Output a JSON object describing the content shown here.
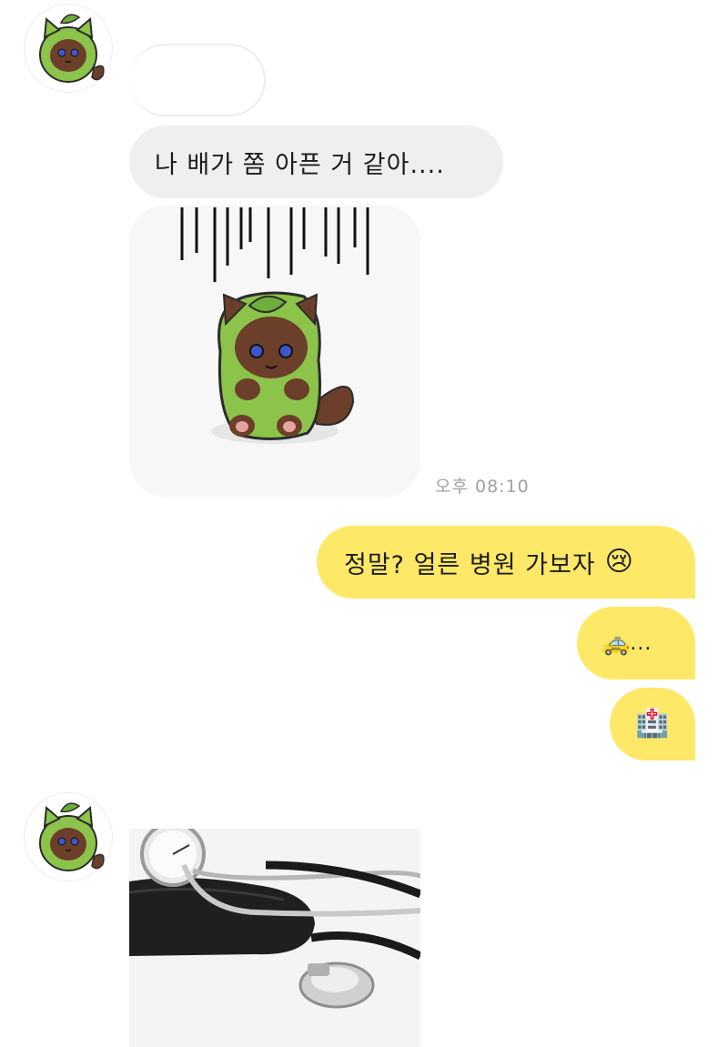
{
  "chat": {
    "messages": [
      {
        "sender": "friend",
        "type": "text",
        "text": "나 배가 쫌 아픈 거 같아...."
      },
      {
        "sender": "friend",
        "type": "sticker",
        "sticker_icon": "green-cat-sticker-icon",
        "time": "오후 08:10"
      },
      {
        "sender": "me",
        "type": "text",
        "text": "정말? 얼른 병원 가보자",
        "emoji": "😢"
      },
      {
        "sender": "me",
        "type": "text",
        "text": "...",
        "emoji": "🚕"
      },
      {
        "sender": "me",
        "type": "text",
        "emoji": "🏥"
      },
      {
        "sender": "friend",
        "type": "photo",
        "photo_icon": "stethoscope-photo-icon"
      }
    ]
  },
  "colors": {
    "incoming_bubble": "#efefef",
    "outgoing_bubble": "#fee868",
    "avatar_green": "#8cc34a",
    "timestamp_gray": "#a0a0a0"
  }
}
